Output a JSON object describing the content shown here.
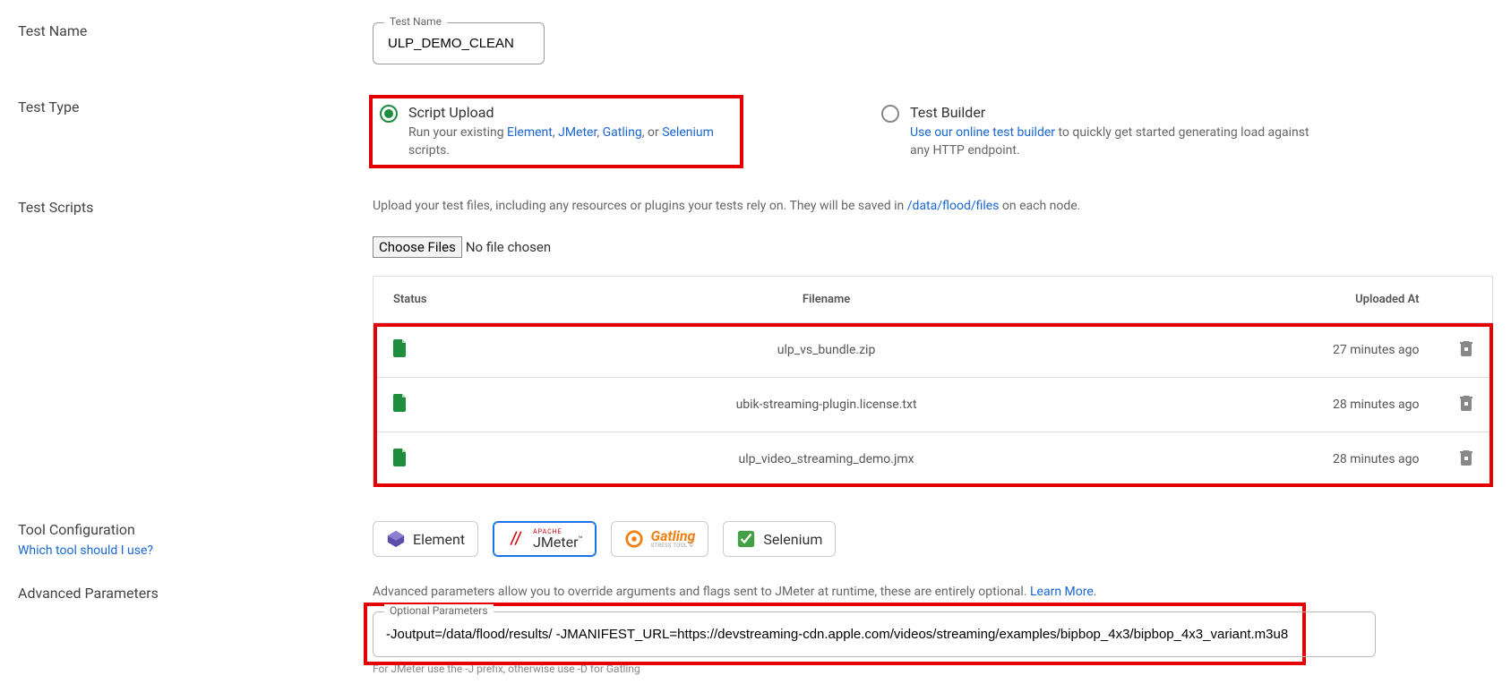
{
  "labels": {
    "test_name": "Test Name",
    "test_type": "Test Type",
    "test_scripts": "Test Scripts",
    "tool_config": "Tool Configuration",
    "tool_config_link": "Which tool should I use?",
    "advanced": "Advanced Parameters"
  },
  "test_name": {
    "float_label": "Test Name",
    "value": "ULP_DEMO_CLEAN"
  },
  "test_type": {
    "script_upload": {
      "title": "Script Upload",
      "desc_pre": "Run your existing ",
      "link1": "Element",
      "sep1": ", ",
      "link2": "JMeter",
      "sep2": ", ",
      "link3": "Gatling",
      "sep3": ", or ",
      "link4": "Selenium",
      "desc_post": " scripts."
    },
    "test_builder": {
      "title": "Test Builder",
      "link": "Use our online test builder",
      "desc_post": " to quickly get started generating load against any HTTP endpoint."
    }
  },
  "scripts": {
    "help_pre": "Upload your test files, including any resources or plugins your tests rely on. They will be saved in ",
    "help_link": "/data/flood/files",
    "help_post": " on each node.",
    "choose_btn": "Choose Files",
    "choose_status": "No file chosen",
    "headers": {
      "status": "Status",
      "filename": "Filename",
      "uploaded": "Uploaded At"
    },
    "rows": [
      {
        "filename": "ulp_vs_bundle.zip",
        "uploaded": "27 minutes ago"
      },
      {
        "filename": "ubik-streaming-plugin.license.txt",
        "uploaded": "28 minutes ago"
      },
      {
        "filename": "ulp_video_streaming_demo.jmx",
        "uploaded": "28 minutes ago"
      }
    ]
  },
  "tools": {
    "element": "Element",
    "jmeter_apache": "APACHE",
    "jmeter": "JMeter",
    "jmeter_tm": "™",
    "gatling": "Gatling",
    "gatling_sub": "STRESS TOOL ©",
    "selenium": "Selenium"
  },
  "advanced": {
    "help_pre": "Advanced parameters allow you to override arguments and flags sent to JMeter at runtime, these are entirely optional. ",
    "learn_more": "Learn More",
    "help_post": ".",
    "float_label": "Optional Parameters",
    "value": "-Joutput=/data/flood/results/ -JMANIFEST_URL=https://devstreaming-cdn.apple.com/videos/streaming/examples/bipbop_4x3/bipbop_4x3_variant.m3u8",
    "footnote": "For JMeter use the -J prefix, otherwise use -D for Gatling"
  }
}
